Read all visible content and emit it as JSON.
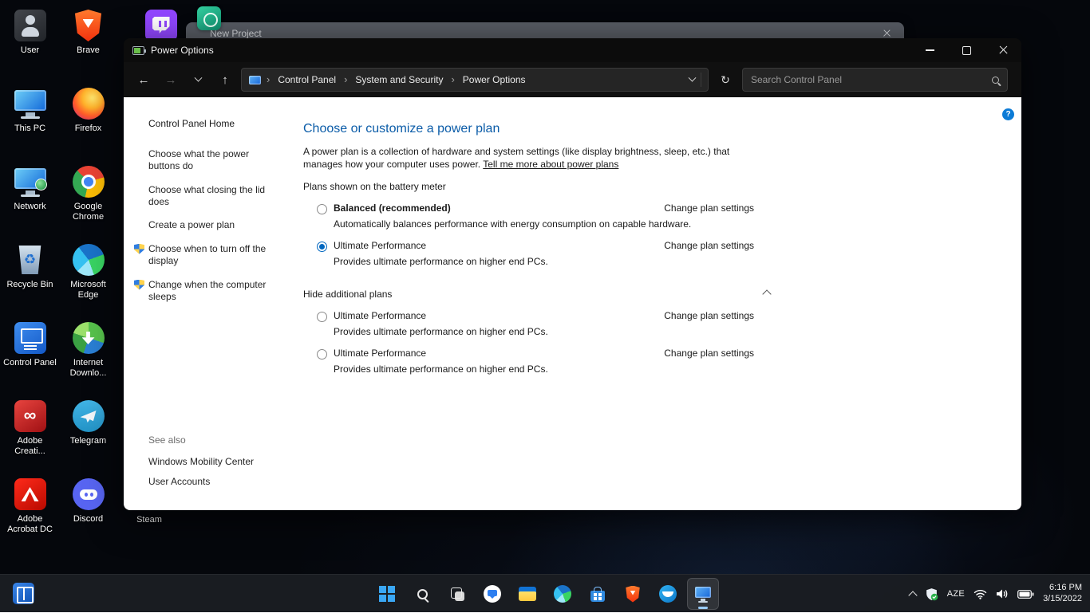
{
  "colors": {
    "accent": "#0067c0",
    "link": "#0066cc",
    "heading": "#0b5ca8",
    "taskbar": "#1a1d22"
  },
  "desktop": {
    "col1": [
      {
        "label": "User"
      },
      {
        "label": "This PC"
      },
      {
        "label": "Network"
      },
      {
        "label": "Recycle Bin"
      },
      {
        "label": "Control Panel"
      },
      {
        "label": "Adobe Creati..."
      },
      {
        "label": "Adobe Acrobat DC"
      }
    ],
    "col2": [
      {
        "label": "Brave"
      },
      {
        "label": "Firefox"
      },
      {
        "label": "Google Chrome"
      },
      {
        "label": "Microsoft Edge"
      },
      {
        "label": "Internet Downlo..."
      },
      {
        "label": "Telegram"
      },
      {
        "label": "Discord"
      }
    ],
    "steam_label": "Steam"
  },
  "background_window": {
    "title": "New Project"
  },
  "powerwin": {
    "title": "Power Options",
    "breadcrumb": {
      "items": [
        "Control Panel",
        "System and Security",
        "Power Options"
      ]
    },
    "search_placeholder": "Search Control Panel",
    "sidebar": {
      "home": "Control Panel Home",
      "links": [
        "Choose what the power buttons do",
        "Choose what closing the lid does",
        "Create a power plan",
        "Choose when to turn off the display",
        "Change when the computer sleeps"
      ],
      "see_also": "See also",
      "see_also_links": [
        "Windows Mobility Center",
        "User Accounts"
      ]
    },
    "main": {
      "heading": "Choose or customize a power plan",
      "intro": "A power plan is a collection of hardware and system settings (like display brightness, sleep, etc.) that manages how your computer uses power.",
      "intro_link": "Tell me more about power plans",
      "section1_label": "Plans shown on the battery meter",
      "section2_label": "Hide additional plans",
      "plans": [
        {
          "name": "Balanced (recommended)",
          "desc": "Automatically balances performance with energy consumption on capable hardware.",
          "link": "Change plan settings",
          "state": "unchecked"
        },
        {
          "name": "Ultimate Performance",
          "desc": "Provides ultimate performance on higher end PCs.",
          "link": "Change plan settings",
          "state": "checked"
        },
        {
          "name": "Ultimate Performance",
          "desc": "Provides ultimate performance on higher end PCs.",
          "link": "Change plan settings",
          "state": "unchecked"
        },
        {
          "name": "Ultimate Performance",
          "desc": "Provides ultimate performance on higher end PCs.",
          "link": "Change plan settings",
          "state": "unchecked"
        }
      ]
    }
  },
  "taskbar": {
    "language": "AZE",
    "time": "6:16 PM",
    "date": "3/15/2022"
  }
}
